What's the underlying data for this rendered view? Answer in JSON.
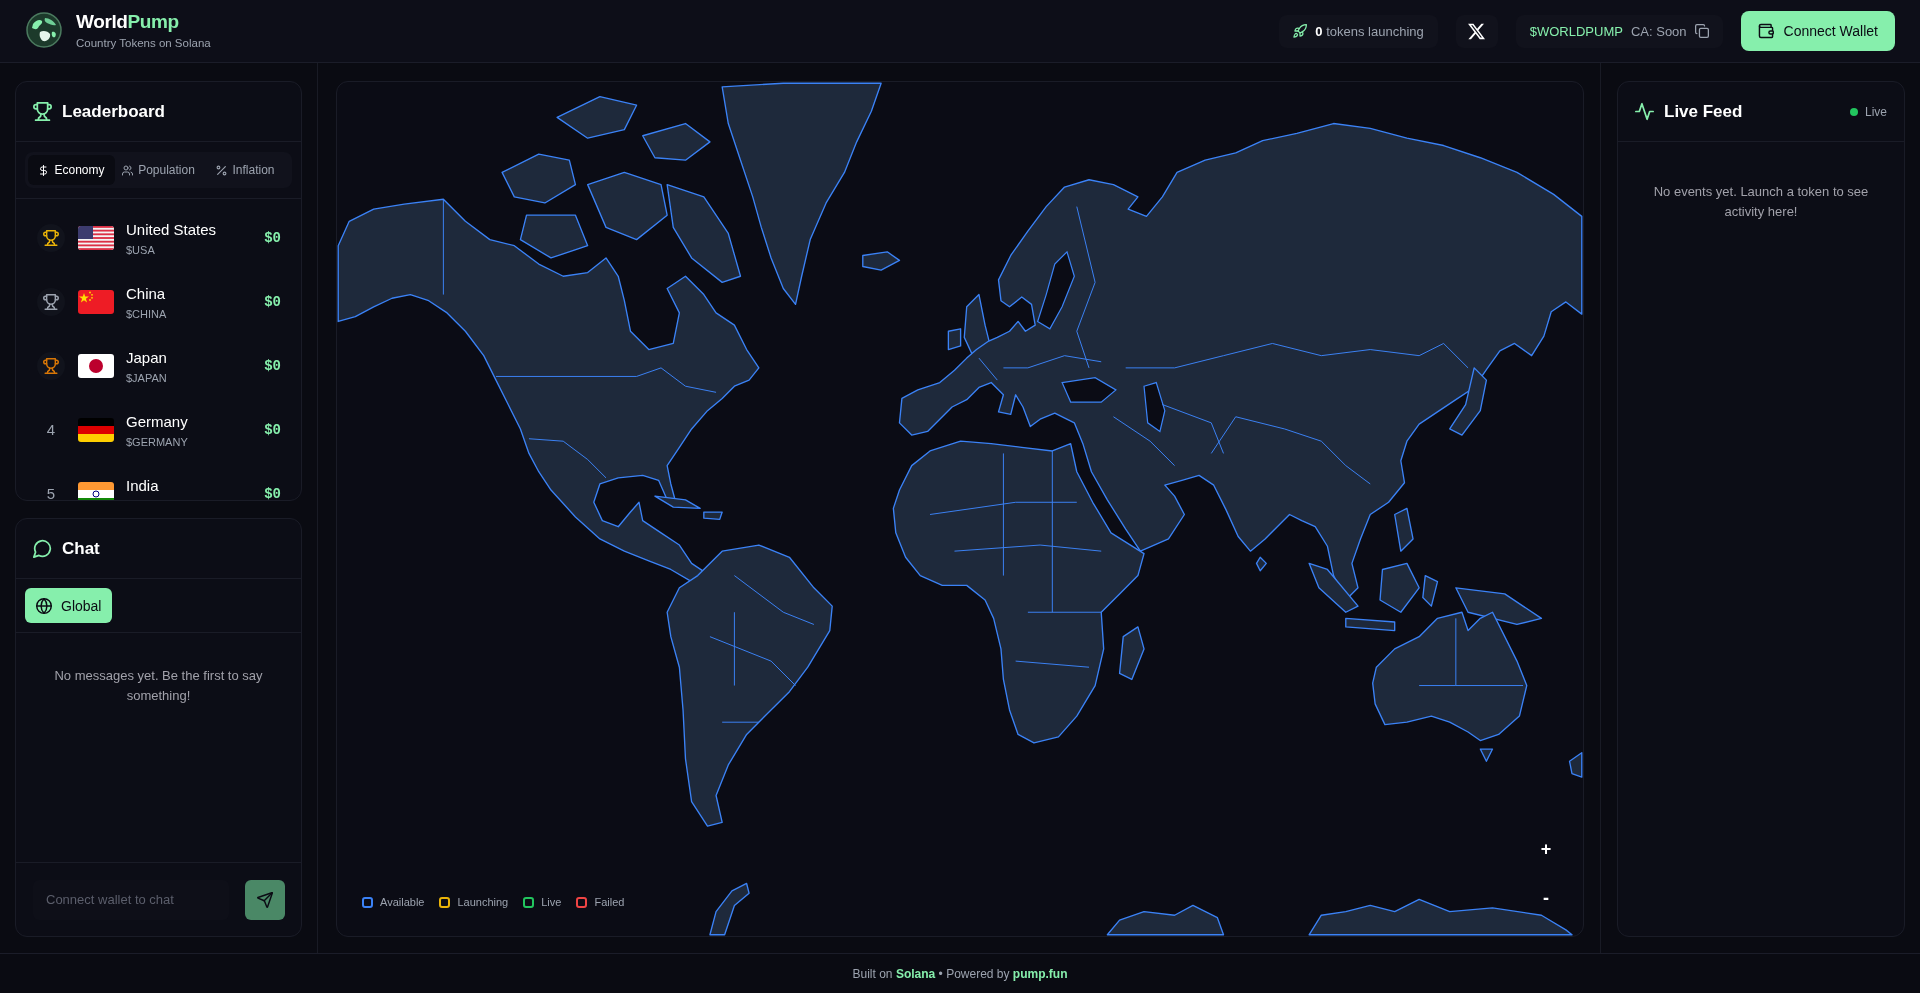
{
  "header": {
    "brand": {
      "name": "World",
      "name_accent": "Pump",
      "tagline": "Country Tokens on Solana"
    },
    "launch_counter": {
      "count": "0",
      "label": "tokens launching"
    },
    "token": {
      "ticker": "$WORLDPUMP",
      "contract": "CA: Soon"
    },
    "connect_button": "Connect Wallet"
  },
  "leaderboard": {
    "title": "Leaderboard",
    "tabs": [
      {
        "kind": "economy",
        "label": "Economy",
        "selected": true
      },
      {
        "kind": "population",
        "label": "Population",
        "selected": false
      },
      {
        "kind": "inflation",
        "label": "Inflation",
        "selected": false
      }
    ],
    "rows": [
      {
        "kind": "us",
        "color": "#eab308",
        "name": "United States",
        "ticker": "$USA",
        "value": "$0"
      },
      {
        "kind": "cn",
        "color": "#9ca3af",
        "name": "China",
        "ticker": "$CHINA",
        "value": "$0"
      },
      {
        "kind": "jp",
        "color": "#d97706",
        "name": "Japan",
        "ticker": "$JAPAN",
        "value": "$0"
      },
      {
        "kind": "de",
        "rank": "4",
        "name": "Germany",
        "ticker": "$GERMANY",
        "value": "$0"
      },
      {
        "kind": "in",
        "rank": "5",
        "name": "India",
        "value": "$0"
      }
    ]
  },
  "chat": {
    "title": "Chat",
    "tabs": [
      {
        "label": "Global",
        "selected": true
      }
    ],
    "empty_message": "No messages yet. Be the first to say something!",
    "input": {
      "placeholder": "Connect wallet to chat"
    },
    "send_disabled": true
  },
  "map": {
    "legend": [
      {
        "label": "Available",
        "color": "#3b82f6"
      },
      {
        "label": "Launching",
        "color": "#eab308"
      },
      {
        "label": "Live",
        "color": "#22c55e"
      },
      {
        "label": "Failed",
        "color": "#ef4444"
      }
    ],
    "zoom_in": "+",
    "zoom_out": "-"
  },
  "live_feed": {
    "title": "Live Feed",
    "status": "Live",
    "connected": true,
    "empty_message": "No events yet. Launch a token to see activity here!"
  },
  "footer": {
    "parts": [
      {
        "kind": "text",
        "text": "Built on"
      },
      {
        "kind": "link",
        "text": "Solana"
      },
      {
        "kind": "text",
        "text": "•"
      },
      {
        "kind": "text",
        "text": "Powered by"
      },
      {
        "kind": "link",
        "text": "pump.fun"
      }
    ]
  }
}
